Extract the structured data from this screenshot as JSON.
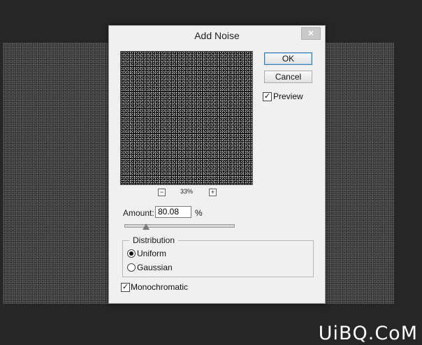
{
  "dialog": {
    "title": "Add Noise",
    "close_glyph": "×"
  },
  "preview": {
    "zoom_out_glyph": "−",
    "zoom_level": "33%",
    "zoom_in_glyph": "+"
  },
  "buttons": {
    "ok": "OK",
    "cancel": "Cancel"
  },
  "preview_toggle": {
    "label": "Preview",
    "checked": true,
    "check_glyph": "✓"
  },
  "amount": {
    "label": "Amount:",
    "value": "80.08",
    "unit": "%",
    "slider_fraction": 0.2
  },
  "distribution": {
    "legend": "Distribution",
    "options": [
      "Uniform",
      "Gaussian"
    ],
    "selected": "Uniform"
  },
  "monochromatic": {
    "label": "Monochromatic",
    "checked": true,
    "check_glyph": "✓"
  },
  "watermark": "UiBQ.CoM",
  "colors": {
    "workspace": "#262626",
    "dialog_bg": "#f0f0f0",
    "default_button_border": "#3c7fb1"
  }
}
